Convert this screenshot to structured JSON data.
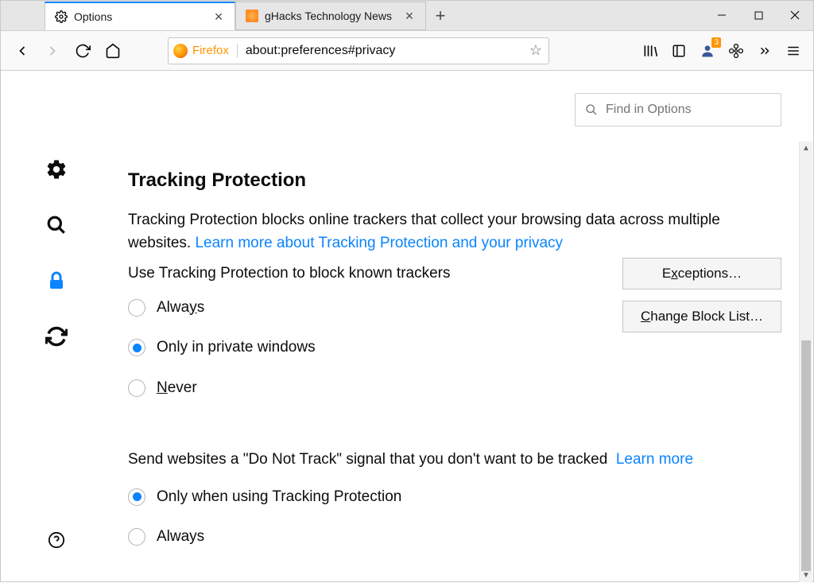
{
  "tabs": [
    {
      "title": "Options",
      "active": true
    },
    {
      "title": "gHacks Technology News",
      "active": false
    }
  ],
  "urlbar": {
    "identity_label": "Firefox",
    "url": "about:preferences#privacy"
  },
  "badge_count": "3",
  "search": {
    "placeholder": "Find in Options"
  },
  "tracking": {
    "heading": "Tracking Protection",
    "description_pre": "Tracking Protection blocks online trackers that collect your browsing data across multiple websites. ",
    "learn_link": "Learn more about Tracking Protection and your privacy",
    "subhead": "Use Tracking Protection to block known trackers",
    "options": {
      "always": "Always",
      "private": "Only in private windows",
      "never": "Never"
    },
    "selected": "private",
    "buttons": {
      "exceptions": "Exceptions…",
      "changelist": "Change Block List…"
    }
  },
  "dnt": {
    "text": "Send websites a \"Do Not Track\" signal that you don't want to be tracked",
    "learn": "Learn more",
    "options": {
      "only_tp": "Only when using Tracking Protection",
      "always": "Always"
    },
    "selected": "only_tp"
  }
}
